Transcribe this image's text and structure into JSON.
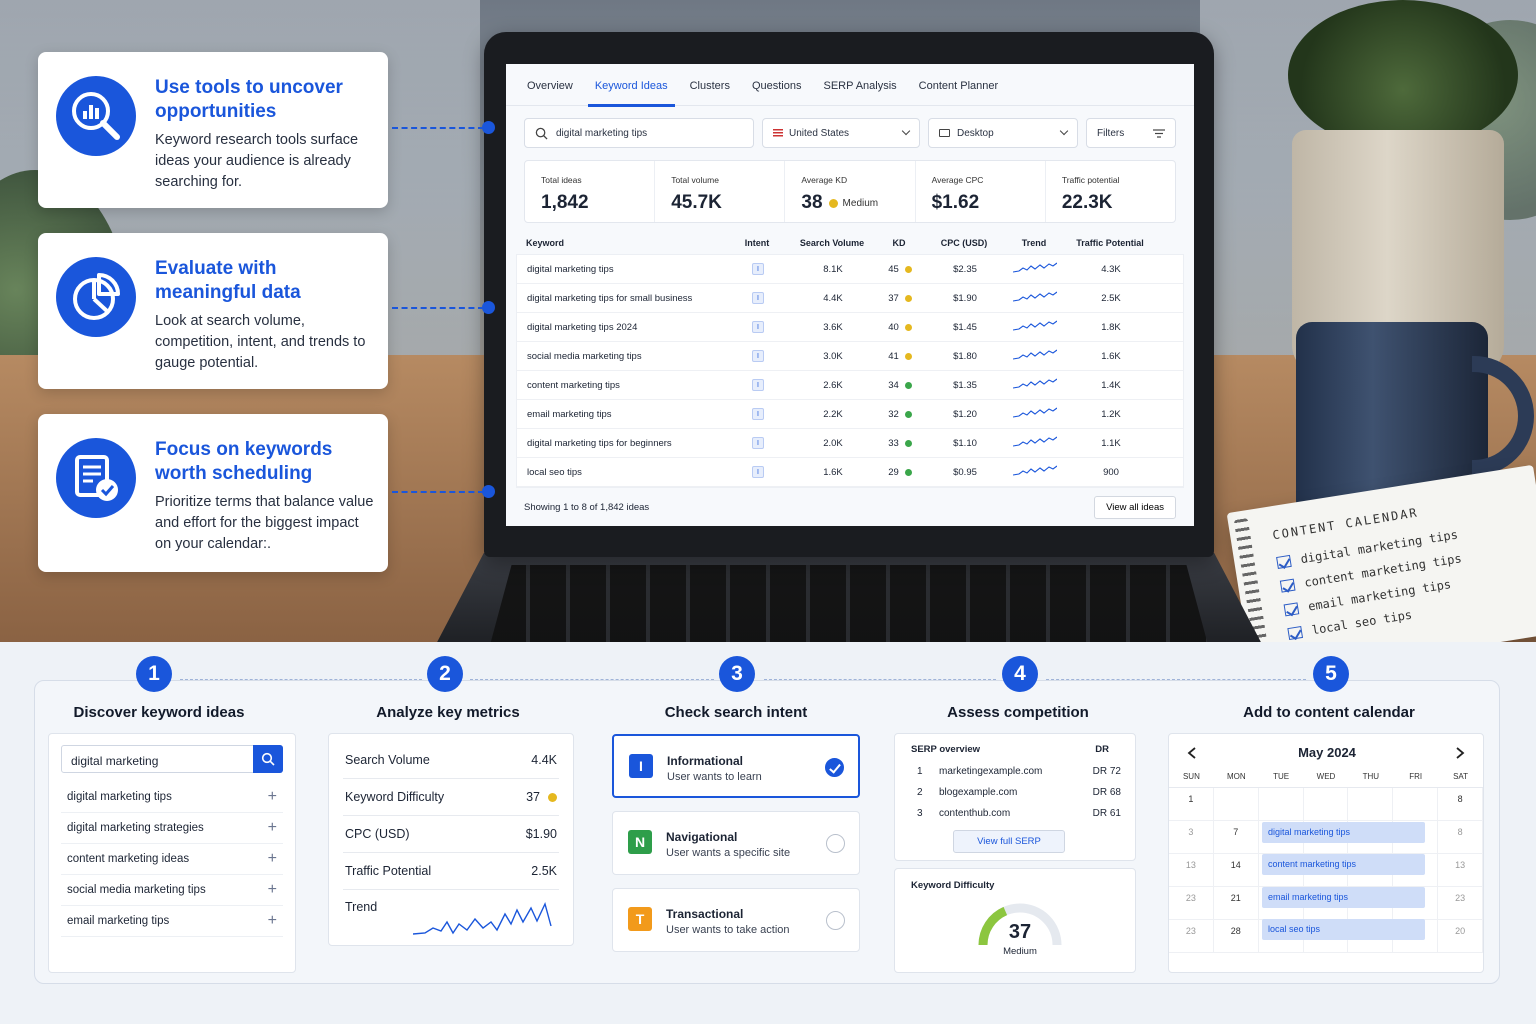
{
  "screen": {
    "tabs": [
      "Overview",
      "Keyword Ideas",
      "Clusters",
      "Questions",
      "SERP Analysis",
      "Content Planner"
    ],
    "search_value": "digital marketing tips",
    "country": "United States",
    "device": "Desktop",
    "filters": "Filters",
    "stats": [
      {
        "label": "Total ideas",
        "value": "1,842"
      },
      {
        "label": "Total volume",
        "value": "45.7K"
      },
      {
        "label": "Average KD",
        "value": "38",
        "note": "Medium"
      },
      {
        "label": "Average CPC",
        "value": "$1.62"
      },
      {
        "label": "Traffic potential",
        "value": "22.3K"
      }
    ],
    "columns": [
      "Keyword",
      "Intent",
      "Search Volume",
      "KD",
      "CPC (USD)",
      "Trend",
      "Traffic Potential"
    ],
    "rows": [
      {
        "kw": "digital marketing tips",
        "intent": "I",
        "vol": "8.1K",
        "kd": "45",
        "kd_color": "#e5b81f",
        "cpc": "$2.35",
        "tp": "4.3K"
      },
      {
        "kw": "digital marketing tips for small business",
        "intent": "I",
        "vol": "4.4K",
        "kd": "37",
        "kd_color": "#e5b81f",
        "cpc": "$1.90",
        "tp": "2.5K"
      },
      {
        "kw": "digital marketing tips 2024",
        "intent": "I",
        "vol": "3.6K",
        "kd": "40",
        "kd_color": "#e5b81f",
        "cpc": "$1.45",
        "tp": "1.8K"
      },
      {
        "kw": "social media marketing tips",
        "intent": "I",
        "vol": "3.0K",
        "kd": "41",
        "kd_color": "#e5b81f",
        "cpc": "$1.80",
        "tp": "1.6K"
      },
      {
        "kw": "content marketing tips",
        "intent": "I",
        "vol": "2.6K",
        "kd": "34",
        "kd_color": "#3aa64a",
        "cpc": "$1.35",
        "tp": "1.4K"
      },
      {
        "kw": "email marketing tips",
        "intent": "I",
        "vol": "2.2K",
        "kd": "32",
        "kd_color": "#3aa64a",
        "cpc": "$1.20",
        "tp": "1.2K"
      },
      {
        "kw": "digital marketing tips for beginners",
        "intent": "I",
        "vol": "2.0K",
        "kd": "33",
        "kd_color": "#3aa64a",
        "cpc": "$1.10",
        "tp": "1.1K"
      },
      {
        "kw": "local seo tips",
        "intent": "I",
        "vol": "1.6K",
        "kd": "29",
        "kd_color": "#3aa64a",
        "cpc": "$0.95",
        "tp": "900"
      }
    ],
    "showing": "Showing 1 to 8 of 1,842 ideas",
    "view_all": "View all ideas"
  },
  "callouts": [
    {
      "title": "Use tools to uncover opportunities",
      "body": "Keyword research tools surface ideas your audience is already searching for.",
      "icon": "magnifier-chart-icon"
    },
    {
      "title": "Evaluate with meaningful data",
      "body": "Look at search volume, competition, intent, and trends to gauge potential.",
      "icon": "pie-chart-icon"
    },
    {
      "title": "Focus on keywords worth scheduling",
      "body": "Prioritize terms that balance value and effort for the biggest impact on your calendar:.",
      "icon": "document-check-icon"
    }
  ],
  "notebook": {
    "title": "CONTENT CALENDAR",
    "items": [
      "digital marketing tips",
      "content marketing tips",
      "email marketing tips",
      "local seo tips"
    ]
  },
  "steps": [
    {
      "num": "1",
      "title": "Discover keyword ideas"
    },
    {
      "num": "2",
      "title": "Analyze key metrics"
    },
    {
      "num": "3",
      "title": "Check search intent"
    },
    {
      "num": "4",
      "title": "Assess competition"
    },
    {
      "num": "5",
      "title": "Add to content calendar"
    }
  ],
  "discover": {
    "search": "digital marketing",
    "items": [
      "digital marketing tips",
      "digital marketing strategies",
      "content marketing ideas",
      "social media marketing tips",
      "email marketing tips"
    ]
  },
  "metrics": [
    {
      "label": "Search Volume",
      "value": "4.4K"
    },
    {
      "label": "Keyword Difficulty",
      "value": "37"
    },
    {
      "label": "CPC (USD)",
      "value": "$1.90"
    },
    {
      "label": "Traffic Potential",
      "value": "2.5K"
    },
    {
      "label": "Trend",
      "value": ""
    }
  ],
  "intents": [
    {
      "letter": "I",
      "title": "Informational",
      "sub": "User wants to learn",
      "color": "#1a56db",
      "selected": true
    },
    {
      "letter": "N",
      "title": "Navigational",
      "sub": "User wants a specific site",
      "color": "#2e9e4a",
      "selected": false
    },
    {
      "letter": "T",
      "title": "Transactional",
      "sub": "User wants to take action",
      "color": "#f29a1b",
      "selected": false
    }
  ],
  "serp": {
    "title": "SERP overview",
    "dr_label": "DR",
    "rows": [
      {
        "n": "1",
        "domain": "marketingexample.com",
        "dr": "DR 72"
      },
      {
        "n": "2",
        "domain": "blogexample.com",
        "dr": "DR 68"
      },
      {
        "n": "3",
        "domain": "contenthub.com",
        "dr": "DR 61"
      }
    ],
    "button": "View full SERP",
    "kd_title": "Keyword Difficulty",
    "kd_value": "37",
    "kd_level": "Medium",
    "kd_fraction": 0.37
  },
  "calendar": {
    "month": "May 2024",
    "days": [
      "SUN",
      "MON",
      "TUE",
      "WED",
      "THU",
      "FRI",
      "SAT"
    ],
    "cells": [
      [
        "1",
        "",
        "",
        "",
        "",
        "",
        "8"
      ],
      [
        "3",
        "7",
        "",
        "",
        "",
        "",
        "8"
      ],
      [
        "13",
        "14",
        "",
        "",
        "",
        "",
        "13"
      ],
      [
        "23",
        "21",
        "",
        "",
        "",
        "",
        "23"
      ],
      [
        "23",
        "28",
        "",
        "",
        "",
        "",
        "20"
      ]
    ],
    "events": [
      "digital marketing tips",
      "content marketing tips",
      "email marketing tips",
      "local seo tips"
    ]
  },
  "colors": {
    "accent": "#1a56db",
    "medium": "#e5b81f",
    "easy": "#3aa64a"
  }
}
